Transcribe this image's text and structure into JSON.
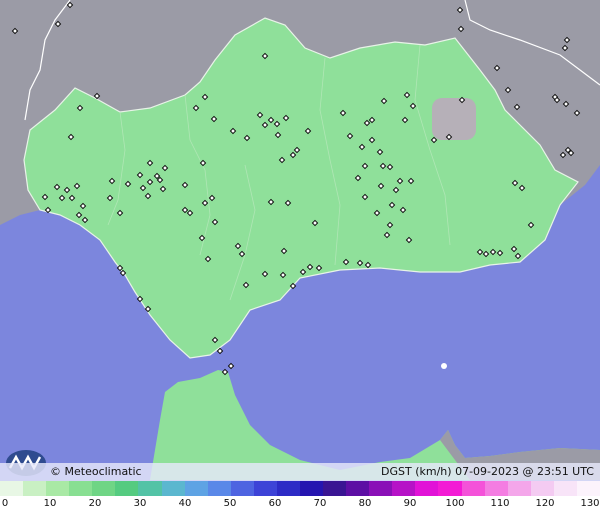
{
  "map": {
    "sea_color": "#7c86dd",
    "land_color": "#9b9ba6",
    "region_color": "#8fe09a",
    "highlight_color": "#b6b0b8"
  },
  "header": {
    "credit": "© Meteoclimatic",
    "title": "DGST (km/h)   07-09-2023 @ 23:51 UTC"
  },
  "legend": {
    "ticks": [
      "0",
      "10",
      "20",
      "30",
      "40",
      "50",
      "60",
      "70",
      "80",
      "90",
      "100",
      "110",
      "120",
      "130"
    ],
    "colors": [
      "#e8f7e5",
      "#c9f0c3",
      "#a9e9a5",
      "#88df92",
      "#6fd585",
      "#55cb80",
      "#53c3a6",
      "#5bb7cf",
      "#5ea3e4",
      "#5a88e8",
      "#4e64e1",
      "#3d43d7",
      "#2d2bc6",
      "#2515b0",
      "#3a1593",
      "#5d0fa4",
      "#8a10b7",
      "#b612c7",
      "#e112d7",
      "#f31bd5",
      "#f452d9",
      "#f47de2",
      "#f4a6ea",
      "#f4cbf2",
      "#f8e4f8",
      "#fcf3fc"
    ]
  }
}
